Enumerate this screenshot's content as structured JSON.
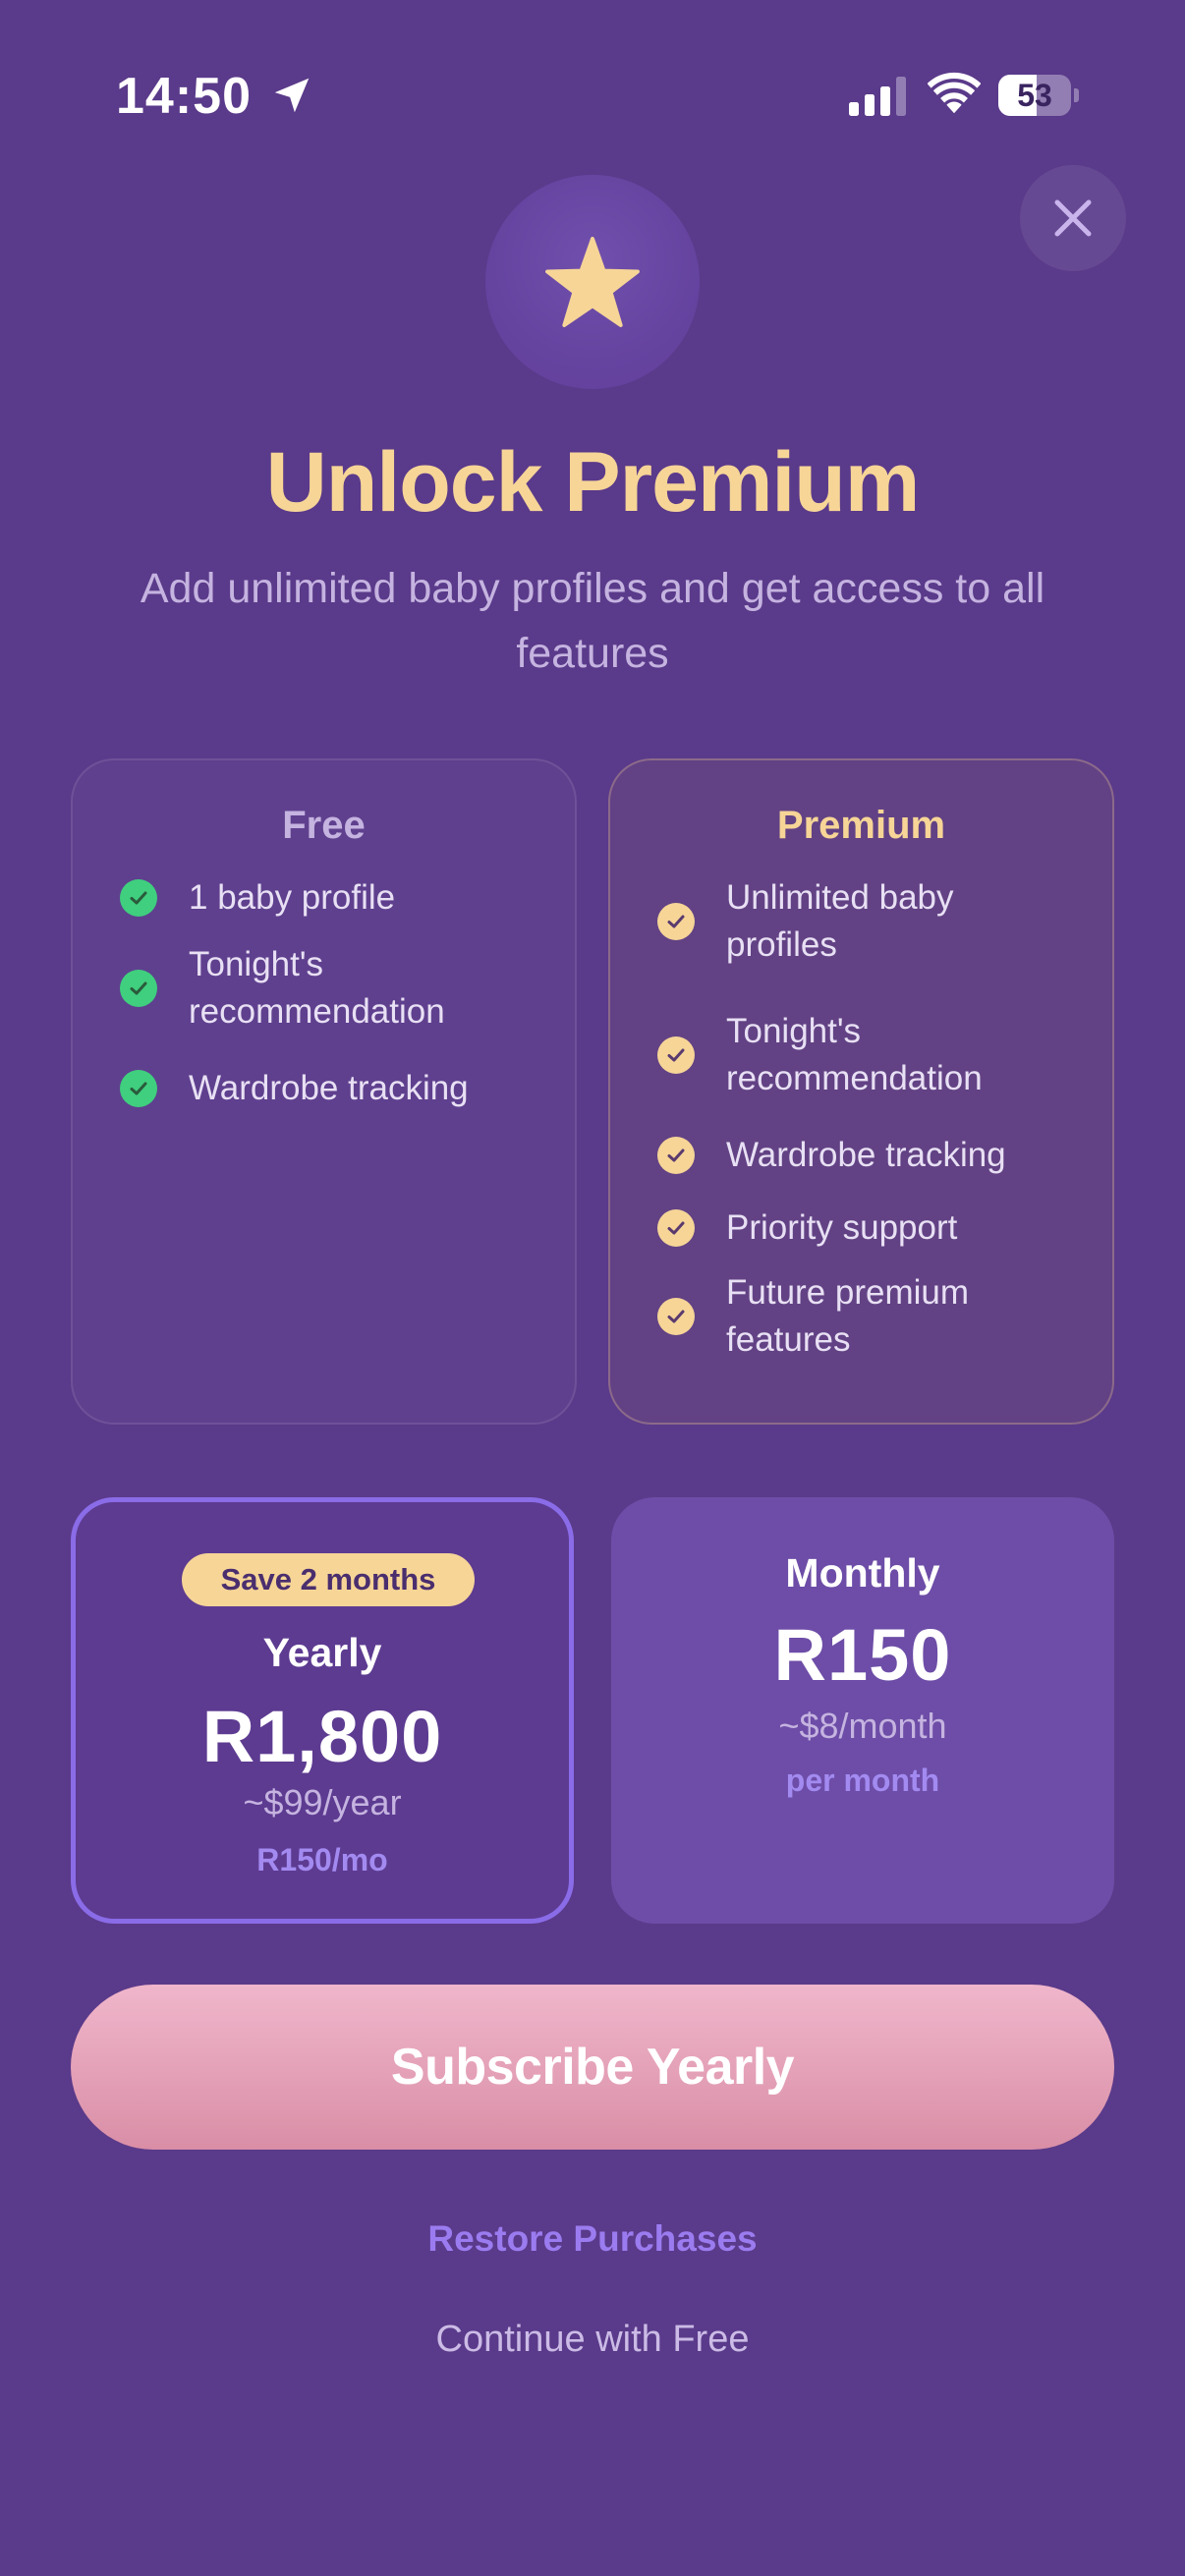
{
  "status_bar": {
    "time": "14:50",
    "battery_level": "53",
    "battery_fraction": 0.53,
    "icons": [
      "location-arrow-icon",
      "cellular-signal-icon",
      "wifi-icon",
      "battery-icon"
    ]
  },
  "header": {
    "close_icon": "close-icon",
    "hero_icon": "star-icon",
    "title": "Unlock Premium",
    "subtitle": "Add unlimited baby profiles and get access to all features"
  },
  "plans": {
    "free": {
      "title": "Free",
      "features": [
        "1 baby profile",
        "Tonight's recommendation",
        "Wardrobe tracking"
      ]
    },
    "premium": {
      "title": "Premium",
      "features": [
        "Unlimited baby profiles",
        "Tonight's recommendation",
        "Wardrobe tracking",
        "Priority support",
        "Future premium features"
      ]
    }
  },
  "pricing": {
    "yearly": {
      "badge": "Save 2 months",
      "name": "Yearly",
      "amount": "R1,800",
      "usd": "~$99/year",
      "per": "R150/mo",
      "selected": true
    },
    "monthly": {
      "name": "Monthly",
      "amount": "R150",
      "usd": "~$8/month",
      "per": "per month",
      "selected": false
    }
  },
  "actions": {
    "subscribe": "Subscribe Yearly",
    "restore": "Restore Purchases",
    "continue_free": "Continue with Free"
  },
  "colors": {
    "background": "#5a3a8a",
    "gold": "#f6d597",
    "accent_purple": "#8a6ce8",
    "check_green": "#3fcf7e",
    "subscribe_pink": "#e7a4bb"
  }
}
